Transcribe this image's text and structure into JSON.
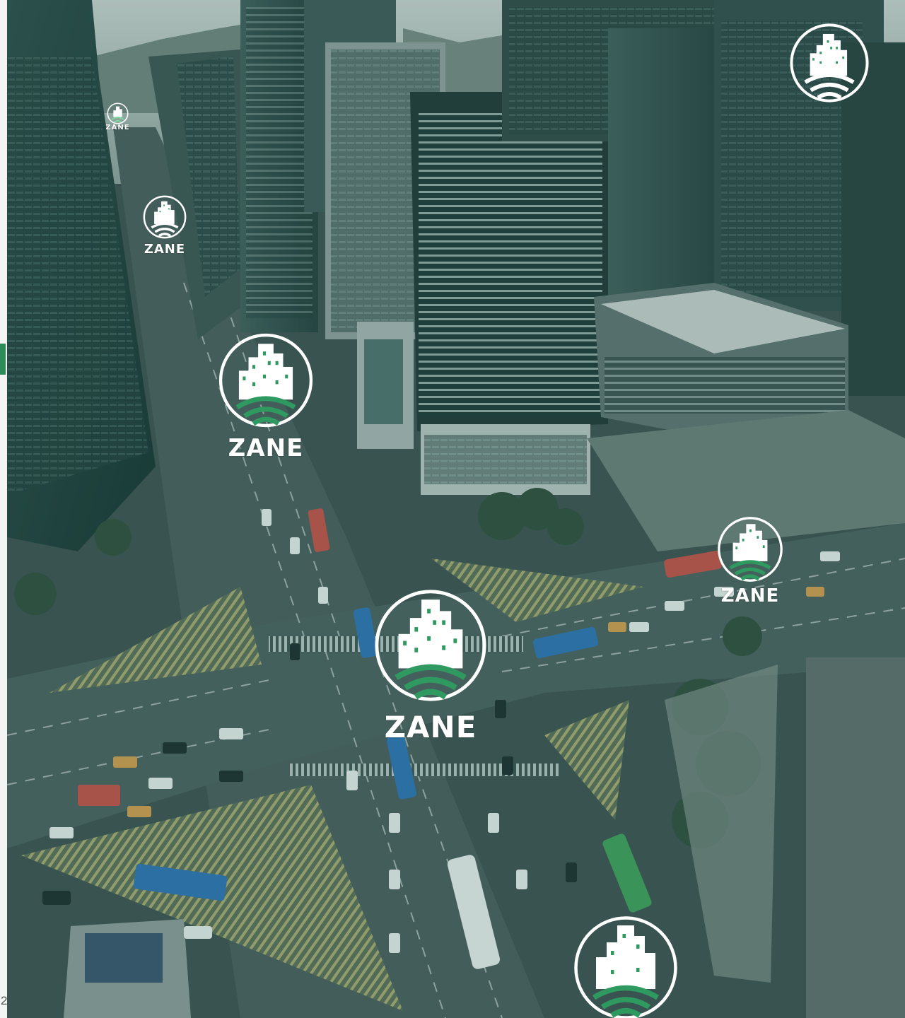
{
  "page": {
    "page_number": "2"
  },
  "photo": {
    "subject_icon": "city-intersection-aerial-photo",
    "tint": "#4f6f6a"
  },
  "brand": {
    "wordmark": "ZANE",
    "icon": "city-skyline-wifi-icon",
    "ring_color": "#ffffff",
    "arc_color": "#2f9a5f",
    "accent": "#2d8b57"
  }
}
